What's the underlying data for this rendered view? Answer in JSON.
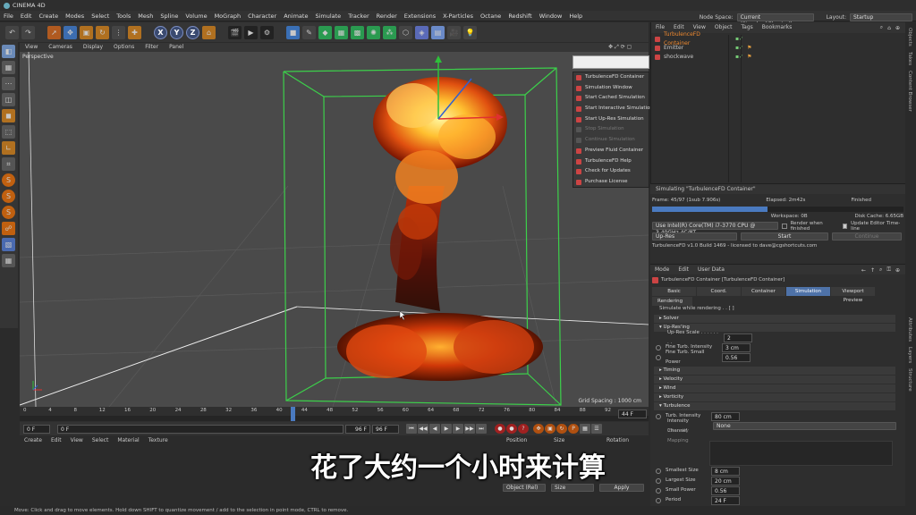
{
  "app": {
    "title": "CINEMA 4D"
  },
  "menubar": [
    "File",
    "Edit",
    "Create",
    "Modes",
    "Select",
    "Tools",
    "Mesh",
    "Spline",
    "Volume",
    "MoGraph",
    "Character",
    "Animate",
    "Simulate",
    "Tracker",
    "Render",
    "Extensions",
    "X-Particles",
    "Octane",
    "Redshift",
    "Window",
    "Help"
  ],
  "nodespace": {
    "label": "Node Space:",
    "value": "Current (Standard/Physical)",
    "layout_label": "Layout:",
    "layout_value": "Startup"
  },
  "toolbar": {
    "axis_x": "X",
    "axis_y": "Y",
    "axis_z": "Z"
  },
  "viewport": {
    "menu": [
      "View",
      "Cameras",
      "Display",
      "Options",
      "Filter",
      "Panel"
    ],
    "camera_label": "Perspective",
    "grid_spacing": "Grid Spacing : 1000 cm"
  },
  "context_menu": {
    "items": [
      {
        "label": "TurbulenceFD Container",
        "disabled": false
      },
      {
        "label": "Simulation Window",
        "disabled": false
      },
      {
        "label": "Start Cached Simulation",
        "disabled": false
      },
      {
        "label": "Start Interactive Simulation",
        "disabled": false
      },
      {
        "label": "Start Up-Res Simulation",
        "disabled": false
      },
      {
        "label": "Stop Simulation",
        "disabled": true
      },
      {
        "label": "Continue Simulation",
        "disabled": true
      },
      {
        "label": "Preview Fluid Container",
        "disabled": false
      },
      {
        "label": "TurbulenceFD Help",
        "disabled": false
      },
      {
        "label": "Check for Updates",
        "disabled": false
      },
      {
        "label": "Purchase License",
        "disabled": false
      }
    ]
  },
  "timeline": {
    "ticks": [
      "0",
      "4",
      "8",
      "12",
      "16",
      "20",
      "24",
      "28",
      "32",
      "36",
      "40",
      "44",
      "48",
      "52",
      "56",
      "60",
      "64",
      "68",
      "72",
      "76",
      "80",
      "84",
      "88",
      "92"
    ],
    "current_frame": "44 F",
    "end_frame": "96 F"
  },
  "transport": {
    "start": "0 F",
    "min": "0 F",
    "max": "96 F",
    "end": "96 F"
  },
  "material_menu": [
    "Create",
    "Edit",
    "View",
    "Select",
    "Material",
    "Texture"
  ],
  "coords": {
    "headers": [
      "Position",
      "Size",
      "Rotation"
    ],
    "mode": "Object (Rel)",
    "size_mode": "Size",
    "apply": "Apply"
  },
  "subtitle": "花了大约一个小时来计算",
  "status": "Move: Click and drag to move elements. Hold down SHIFT to quantize movement / add to the selection in point mode, CTRL to remove.",
  "objects": {
    "menu": [
      "File",
      "Edit",
      "View",
      "Object",
      "Tags",
      "Bookmarks"
    ],
    "items": [
      {
        "name": "TurbulenceFD Container",
        "selected": true
      },
      {
        "name": "Emitter",
        "selected": false
      },
      {
        "name": "shockwave",
        "selected": false
      }
    ]
  },
  "side_tabs": [
    "Objects",
    "Takes",
    "Content Browser",
    "Attributes",
    "Layers",
    "Structure"
  ],
  "simulation": {
    "title": "Simulating \"TurbulenceFD Container\"",
    "frame": "Frame: 45/97 (1sub 7.906s)",
    "elapsed": "Elapsed: 2m42s",
    "state": "Finished",
    "progress": 0.46,
    "workspace": "Workspace: 0B",
    "disk_cache": "Disk Cache: 6.65GB",
    "device": "Use  Intel(R) Core(TM) i7-3770 CPU @ 3.40GHz 4C/8T",
    "render_finished": "Render when finished",
    "update_editor": "Update Editor Time-line",
    "upres": "Up-Res",
    "start": "Start",
    "continue": "Continue",
    "license": "TurbulenceFD v1.0 Build 1469 - licensed to dave@cgshortcuts.com"
  },
  "attributes": {
    "menu": [
      "Mode",
      "Edit",
      "User Data"
    ],
    "object": "TurbulenceFD Container [TurbulenceFD Container]",
    "tabs": [
      {
        "label": "Basic",
        "active": false
      },
      {
        "label": "Coord.",
        "active": false
      },
      {
        "label": "Container",
        "active": false
      },
      {
        "label": "Simulation",
        "active": true
      },
      {
        "label": "Viewport Preview",
        "active": false
      }
    ],
    "rendering_tab": "Rendering",
    "simulate_while_rendering": "Simulate while rendering . . [ ]",
    "sec_solver": "Solver",
    "sec_upres": "Up-Res'ing",
    "upres_scale_label": "Up-Res Scale . . . . . . . .",
    "upres_scale": "2",
    "fine_turb_label": "Fine Turb. Intensity",
    "fine_turb": "3 cm",
    "fine_small_label": "Fine Turb. Small Power",
    "fine_small": "0.56",
    "sec_timing": "Timing",
    "sec_velocity": "Velocity",
    "sec_wind": "Wind",
    "sec_vorticity": "Vorticity",
    "sec_turbulence": "Turbulence",
    "turb_int_label": "Turb. Intensity",
    "turb_int": "80 cm",
    "int_channel_label": "Intensity Channel",
    "int_channel": "None",
    "int_mapping_label": "Intensity Mapping",
    "smallest_label": "Smallest Size",
    "smallest": "8 cm",
    "largest_label": "Largest Size",
    "largest": "20 cm",
    "smallpow_label": "Small Power",
    "smallpow": "0.56",
    "period_label": "Period",
    "period": "24 F"
  }
}
